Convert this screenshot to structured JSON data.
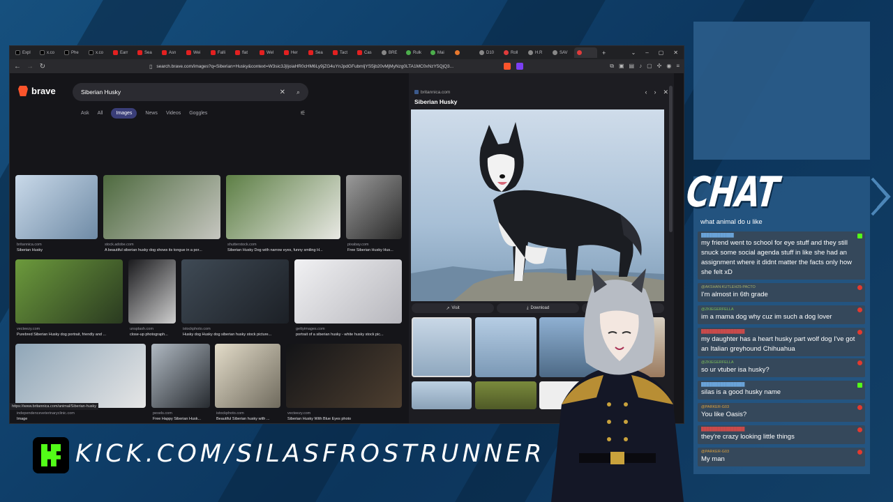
{
  "browser": {
    "tabs": [
      {
        "label": "Expl",
        "icon": "x-icon"
      },
      {
        "label": "x.co",
        "icon": "x-icon"
      },
      {
        "label": "Phe",
        "icon": "x-icon"
      },
      {
        "label": "x.co",
        "icon": "x-icon"
      },
      {
        "label": "Earr",
        "icon": "youtube-icon"
      },
      {
        "label": "Sea",
        "icon": "youtube-icon"
      },
      {
        "label": "Asn",
        "icon": "youtube-icon"
      },
      {
        "label": "Wei",
        "icon": "youtube-icon"
      },
      {
        "label": "Falli",
        "icon": "youtube-icon"
      },
      {
        "label": "flat",
        "icon": "youtube-icon"
      },
      {
        "label": "Wel",
        "icon": "youtube-icon"
      },
      {
        "label": "Her",
        "icon": "youtube-icon"
      },
      {
        "label": "Sea",
        "icon": "youtube-icon"
      },
      {
        "label": "Tact",
        "icon": "youtube-icon"
      },
      {
        "label": "Cas",
        "icon": "youtube-icon"
      },
      {
        "label": "BRE",
        "icon": "globe-icon"
      },
      {
        "label": "Rulk",
        "icon": "globe-icon"
      },
      {
        "label": "Mai",
        "icon": "globe-icon"
      },
      {
        "label": "",
        "icon": "globe-icon"
      },
      {
        "label": "D10",
        "icon": "globe-icon"
      },
      {
        "label": "Roll",
        "icon": "globe-icon"
      },
      {
        "label": "H.R",
        "icon": "globe-icon"
      },
      {
        "label": "SAV",
        "icon": "globe-icon"
      },
      {
        "label": "",
        "icon": "globe-icon"
      }
    ],
    "url": "search.brave.com/images?q=Siberian+Husky&context=W3sic3JjIjoiaHR0cHM6Ly9jZG4uYnJpdGFubmljYS5jb20vMjMyNzg0LTA1MC0xNzY5QjQ3...",
    "status_url": "https://www.britannica.com/animal/Siberian-husky"
  },
  "search": {
    "brand": "brave",
    "query": "Siberian Husky",
    "tabs": [
      "Ask",
      "All",
      "Images",
      "News",
      "Videos",
      "Goggles"
    ],
    "active_tab": "Images"
  },
  "results": [
    {
      "source": "britannica.com",
      "title": "Siberian Husky"
    },
    {
      "source": "stock.adobe.com",
      "title": "A beautiful siberian husky dog shows its tongue in a por..."
    },
    {
      "source": "shutterstock.com",
      "title": "Siberian Husky Dog with narrow eyes, funny smiling H..."
    },
    {
      "source": "pixabay.com",
      "title": "Free Siberian Husky Hus..."
    },
    {
      "source": "vecteezy.com",
      "title": "Purebred Siberian Husky dog portrait, friendly and ..."
    },
    {
      "source": "unsplash.com",
      "title": "close-up photograph..."
    },
    {
      "source": "istockphoto.com",
      "title": "Husky dog Husky dog siberian husky stock picture..."
    },
    {
      "source": "gettyimages.com",
      "title": "portrait of a siberian husky - white husky stock pic..."
    },
    {
      "source": "independenceveterinaryclinic.com",
      "title": "Image"
    },
    {
      "source": "pexels.com",
      "title": "Free Happy Siberian Husk..."
    },
    {
      "source": "istockphoto.com",
      "title": "Beautiful Siberian husky with ..."
    },
    {
      "source": "vecteezy.com",
      "title": "Siberian Husky With Blue Eyes photo"
    }
  ],
  "panel": {
    "site": "britannica.com",
    "title": "Siberian Husky",
    "visit_label": "Visit",
    "download_label": "Download"
  },
  "chat": {
    "title": "CHAT",
    "partial_message": "what animal do u like",
    "messages": [
      {
        "user": "████████████",
        "text": "my friend went to school for eye stuff and they still snuck some social agenda stuff in like she had an assignment where it didnt matter the facts only how she felt xD",
        "platform": "kick"
      },
      {
        "user": "@AKSHAN:KUTLEH25-PACTO",
        "text": "I'm almost in 6th grade",
        "platform": "youtube"
      },
      {
        "user": "@ZKIEGERFELLA",
        "text": "im a mama dog why cuz im such a dog lover",
        "platform": "youtube"
      },
      {
        "user": "████████████████",
        "text": "my daughter has a heart husky part wolf dog I've got an Italian greyhound Chihuahua",
        "platform": "youtube"
      },
      {
        "user": "@ZKIEGERFELLA",
        "text": "so ur vtuber isa husky?",
        "platform": "youtube"
      },
      {
        "user": "████████████████",
        "text": "silas is a good husky name",
        "platform": "kick"
      },
      {
        "user": "@PARKER-G03",
        "text": "You like Oasis?",
        "platform": "youtube"
      },
      {
        "user": "████████████████",
        "text": "they're crazy looking little things",
        "platform": "youtube"
      },
      {
        "user": "@PARKER-G03",
        "text": "My man",
        "platform": "youtube"
      }
    ]
  },
  "banner": {
    "url": "KICK.COM/SILASFROSTRUNNER"
  },
  "colors": {
    "kick_green": "#53fc18",
    "brave_orange": "#fb542b",
    "youtube_red": "#e23a2f"
  }
}
